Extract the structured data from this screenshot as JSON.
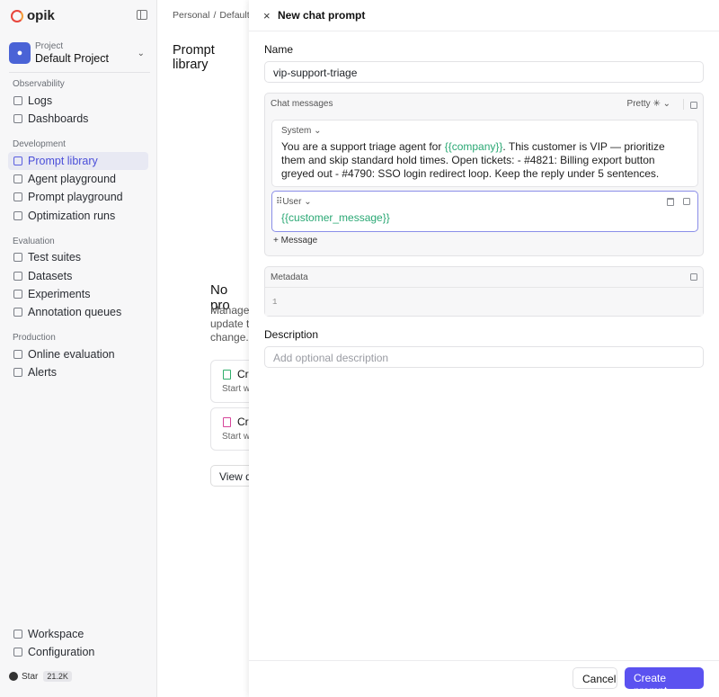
{
  "app": {
    "logo_text": "opik",
    "collapse_icon": "sidebar-collapse-icon"
  },
  "project": {
    "label": "Project",
    "name": "Default Project"
  },
  "sidebar": {
    "sections": [
      {
        "label": "Observability",
        "items": [
          {
            "label": "Logs"
          },
          {
            "label": "Dashboards"
          }
        ]
      },
      {
        "label": "Development",
        "items": [
          {
            "label": "Prompt library",
            "active": true
          },
          {
            "label": "Agent playground"
          },
          {
            "label": "Prompt playground"
          },
          {
            "label": "Optimization runs"
          }
        ]
      },
      {
        "label": "Evaluation",
        "items": [
          {
            "label": "Test suites"
          },
          {
            "label": "Datasets"
          },
          {
            "label": "Experiments"
          },
          {
            "label": "Annotation queues"
          }
        ]
      },
      {
        "label": "Production",
        "items": [
          {
            "label": "Online evaluation"
          },
          {
            "label": "Alerts"
          }
        ]
      }
    ],
    "bottom": [
      {
        "label": "Workspace"
      },
      {
        "label": "Configuration"
      }
    ],
    "github": {
      "label": "Star",
      "count": "21.2K"
    }
  },
  "main": {
    "breadcrumbs": [
      "Personal",
      "/",
      "Default"
    ],
    "title": "Prompt library",
    "empty_title": "No pro",
    "empty_desc": "Manage update th change.",
    "cards": [
      {
        "title": "Cr",
        "desc": "Start w"
      },
      {
        "title": "Cr",
        "desc": "Start w"
      }
    ],
    "view_button": "View d"
  },
  "panel": {
    "title": "New chat prompt",
    "name_label": "Name",
    "name_value": "vip-support-triage",
    "chat_label": "Chat messages",
    "format_label": "Pretty",
    "system_role": "System",
    "system_text_1": "You are a support triage agent for ",
    "system_var": "{{company}}",
    "system_text_2": ". This customer is VIP — prioritize them and skip standard hold times. Open tickets: - #4821: Billing export button greyed out - #4790: SSO login redirect loop. Keep the reply under 5 sentences.",
    "user_role": "User",
    "user_text": "{{customer_message}}",
    "add_message": "Message",
    "metadata_label": "Metadata",
    "metadata_line": "1",
    "description_label": "Description",
    "description_placeholder": "Add optional description",
    "cancel": "Cancel",
    "create": "Create prompt"
  },
  "colors": {
    "accent": "#5b52f0",
    "variable": "#2aa874",
    "active_nav": "#4b4fd9"
  }
}
